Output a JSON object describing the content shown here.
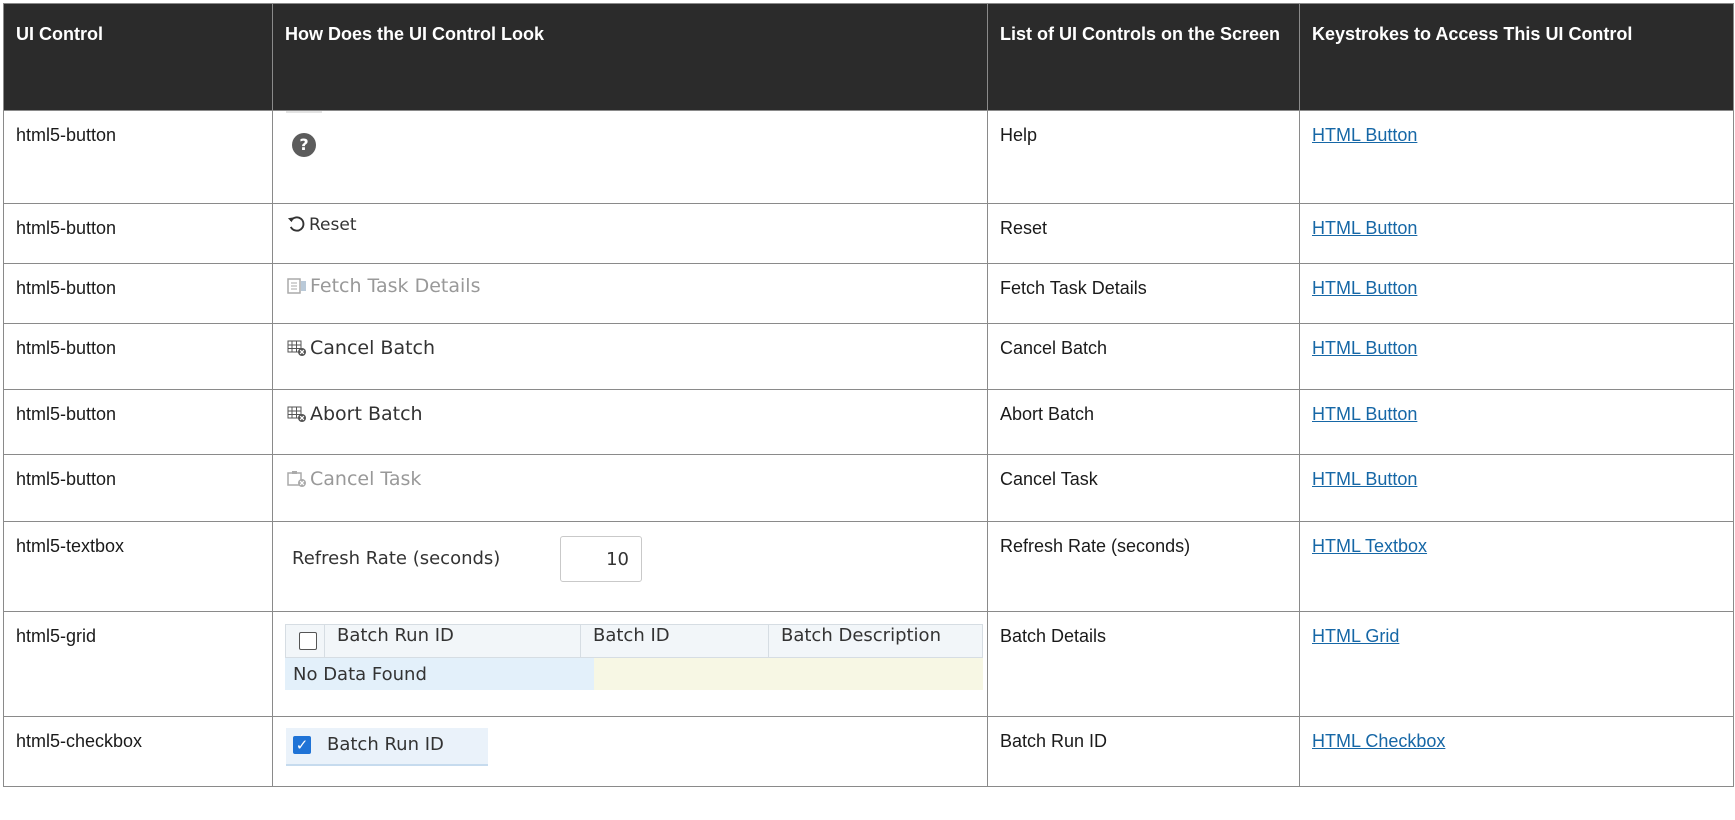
{
  "columns": [
    "UI Control",
    "How Does the UI Control Look",
    "List of UI Controls on the Screen",
    "Keystrokes to Access This UI Control"
  ],
  "rows": [
    {
      "control": "html5-button",
      "look": "?",
      "list": "Help",
      "link": "HTML Button"
    },
    {
      "control": "html5-button",
      "look": "Reset",
      "list": "Reset",
      "link": "HTML Button"
    },
    {
      "control": "html5-button",
      "look": "Fetch Task Details",
      "list": "Fetch Task Details",
      "link": "HTML Button"
    },
    {
      "control": "html5-button",
      "look": "Cancel Batch",
      "list": "Cancel Batch",
      "link": "HTML Button"
    },
    {
      "control": "html5-button",
      "look": "Abort Batch",
      "list": "Abort Batch",
      "link": "HTML Button"
    },
    {
      "control": "html5-button",
      "look": "Cancel Task",
      "list": "Cancel Task",
      "link": "HTML Button"
    },
    {
      "control": "html5-textbox",
      "look": "Refresh Rate (seconds)",
      "value": "10",
      "list": "Refresh Rate (seconds)",
      "link": "HTML Textbox"
    },
    {
      "control": "html5-grid",
      "grid_headers": [
        "Batch Run ID",
        "Batch ID",
        "Batch Description"
      ],
      "grid_empty": "No Data Found",
      "list": "Batch Details",
      "link": "HTML Grid"
    },
    {
      "control": "html5-checkbox",
      "look": "Batch Run ID",
      "list": "Batch Run ID",
      "link": "HTML Checkbox"
    }
  ],
  "colors": {
    "header_bg": "#2b2b2b",
    "link": "#1667a6",
    "checkbox": "#1f73d6"
  }
}
